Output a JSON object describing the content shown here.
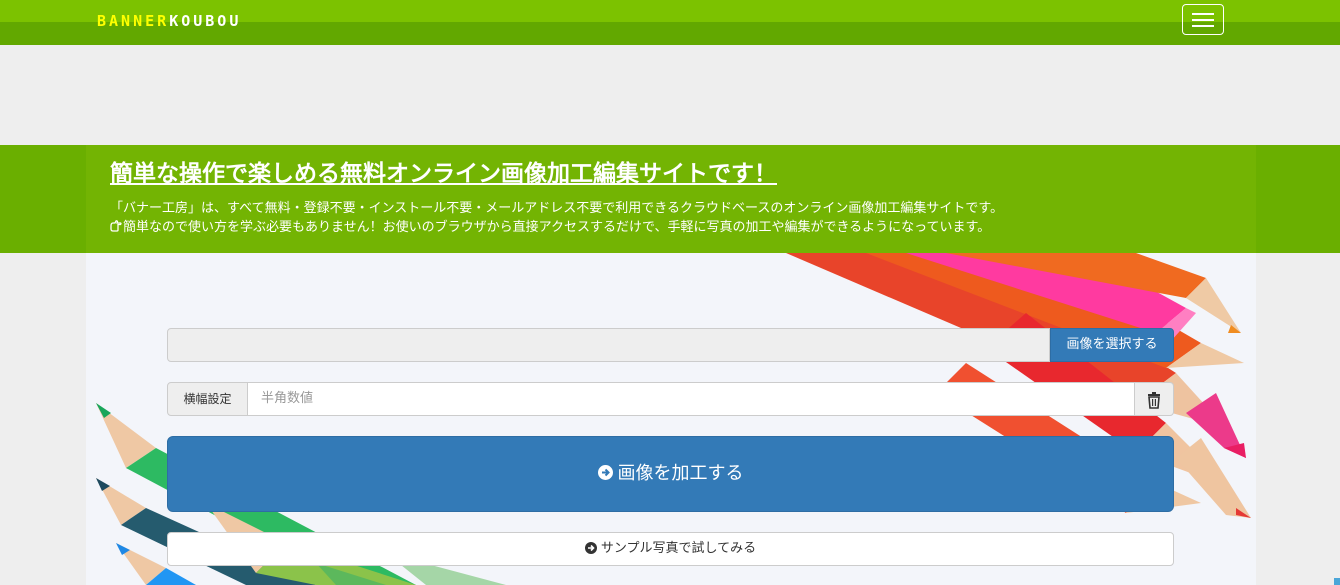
{
  "navbar": {
    "logo_part1": "BANNER",
    "logo_part2": "KOUBOU",
    "menu_icon": "hamburger-icon"
  },
  "intro": {
    "title": "簡単な操作で楽しめる無料オンライン画像加工編集サイトです！",
    "line1": "「バナー工房」は、すべて無料・登録不要・インストール不要・メールアドレス不要で利用できるクラウドベースのオンライン画像加工編集サイトです。",
    "line2": "簡単なので使い方を学ぶ必要もありません！お使いのブラウザから直接アクセスするだけで、手軽に写真の加工や編集ができるようになっています。",
    "line2_icon": "hand-point-right-icon"
  },
  "form": {
    "file_value": "",
    "select_image_label": "画像を選択する",
    "width_label": "横幅設定",
    "width_placeholder": "半角数値",
    "clear_icon": "trash-icon",
    "process_label": "画像を加工する",
    "process_icon": "arrow-circle-right-icon",
    "sample_label": "サンプル写真で試してみる",
    "sample_icon": "arrow-circle-right-icon"
  },
  "colors": {
    "brand_green": "#73b403",
    "logo_yellow": "#ffff00",
    "primary_blue": "#337ab7"
  }
}
